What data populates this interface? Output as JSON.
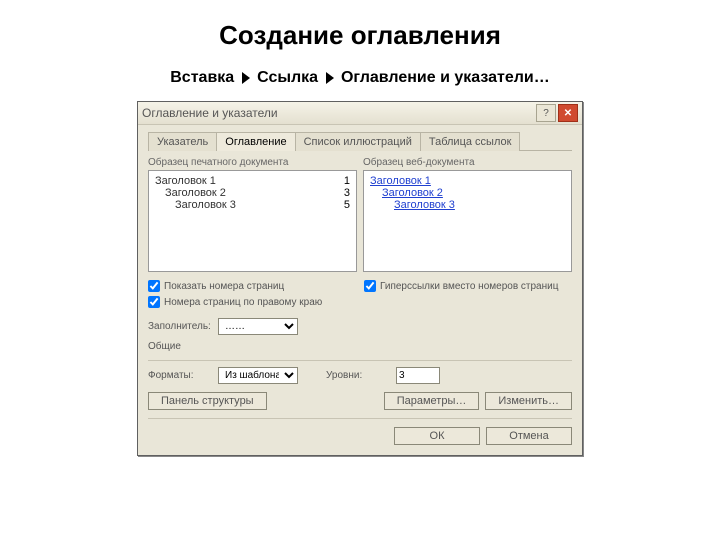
{
  "slide": {
    "title": "Создание оглавления",
    "path": [
      "Вставка",
      "Ссылка",
      "Оглавление и указатели…"
    ]
  },
  "dialog": {
    "title": "Оглавление и указатели",
    "tabs": [
      {
        "label": "Указатель",
        "active": false
      },
      {
        "label": "Оглавление",
        "active": true
      },
      {
        "label": "Список иллюстраций",
        "active": false
      },
      {
        "label": "Таблица ссылок",
        "active": false
      }
    ],
    "preview_print_label": "Образец печатного документа",
    "preview_web_label": "Образец веб-документа",
    "toc_sample": [
      {
        "level": 1,
        "text": "Заголовок 1",
        "page": "1"
      },
      {
        "level": 2,
        "text": "Заголовок 2",
        "page": "3"
      },
      {
        "level": 3,
        "text": "Заголовок 3",
        "page": "5"
      }
    ],
    "opts": {
      "show_page_numbers_label": "Показать номера страниц",
      "show_page_numbers": true,
      "right_align_label": "Номера страниц по правому краю",
      "right_align": true,
      "hyperlinks_label": "Гиперссылки вместо номеров страниц",
      "hyperlinks": true,
      "filler_label": "Заполнитель:",
      "filler_value": "……",
      "group_label": "Общие",
      "format_label": "Форматы:",
      "format_value": "Из шаблона",
      "levels_label": "Уровни:",
      "levels_value": "3"
    },
    "buttons": {
      "panel_structure": "Панель структуры",
      "parameters": "Параметры…",
      "modify": "Изменить…",
      "ok": "ОК",
      "cancel": "Отмена"
    }
  }
}
